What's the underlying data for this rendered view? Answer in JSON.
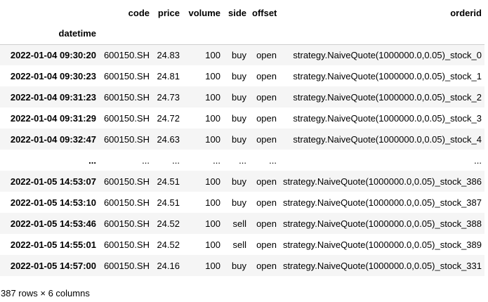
{
  "dataframe": {
    "columns": [
      "code",
      "price",
      "volume",
      "side",
      "offset",
      "orderid"
    ],
    "index_name": "datetime",
    "rows": [
      {
        "index": "2022-01-04 09:30:20",
        "cells": [
          "600150.SH",
          "24.83",
          "100",
          "buy",
          "open",
          "strategy.NaiveQuote(1000000.0,0.05)_stock_0"
        ]
      },
      {
        "index": "2022-01-04 09:30:23",
        "cells": [
          "600150.SH",
          "24.81",
          "100",
          "buy",
          "open",
          "strategy.NaiveQuote(1000000.0,0.05)_stock_1"
        ]
      },
      {
        "index": "2022-01-04 09:31:23",
        "cells": [
          "600150.SH",
          "24.73",
          "100",
          "buy",
          "open",
          "strategy.NaiveQuote(1000000.0,0.05)_stock_2"
        ]
      },
      {
        "index": "2022-01-04 09:31:29",
        "cells": [
          "600150.SH",
          "24.72",
          "100",
          "buy",
          "open",
          "strategy.NaiveQuote(1000000.0,0.05)_stock_3"
        ]
      },
      {
        "index": "2022-01-04 09:32:47",
        "cells": [
          "600150.SH",
          "24.63",
          "100",
          "buy",
          "open",
          "strategy.NaiveQuote(1000000.0,0.05)_stock_4"
        ]
      },
      {
        "index": "...",
        "cells": [
          "...",
          "...",
          "...",
          "...",
          "...",
          "..."
        ]
      },
      {
        "index": "2022-01-05 14:53:07",
        "cells": [
          "600150.SH",
          "24.51",
          "100",
          "buy",
          "open",
          "strategy.NaiveQuote(1000000.0,0.05)_stock_386"
        ]
      },
      {
        "index": "2022-01-05 14:53:10",
        "cells": [
          "600150.SH",
          "24.51",
          "100",
          "buy",
          "open",
          "strategy.NaiveQuote(1000000.0,0.05)_stock_387"
        ]
      },
      {
        "index": "2022-01-05 14:53:46",
        "cells": [
          "600150.SH",
          "24.52",
          "100",
          "sell",
          "open",
          "strategy.NaiveQuote(1000000.0,0.05)_stock_388"
        ]
      },
      {
        "index": "2022-01-05 14:55:01",
        "cells": [
          "600150.SH",
          "24.52",
          "100",
          "sell",
          "open",
          "strategy.NaiveQuote(1000000.0,0.05)_stock_389"
        ]
      },
      {
        "index": "2022-01-05 14:57:00",
        "cells": [
          "600150.SH",
          "24.16",
          "100",
          "buy",
          "open",
          "strategy.NaiveQuote(1000000.0,0.05)_stock_331"
        ]
      }
    ],
    "footer": "387 rows × 6 columns"
  }
}
